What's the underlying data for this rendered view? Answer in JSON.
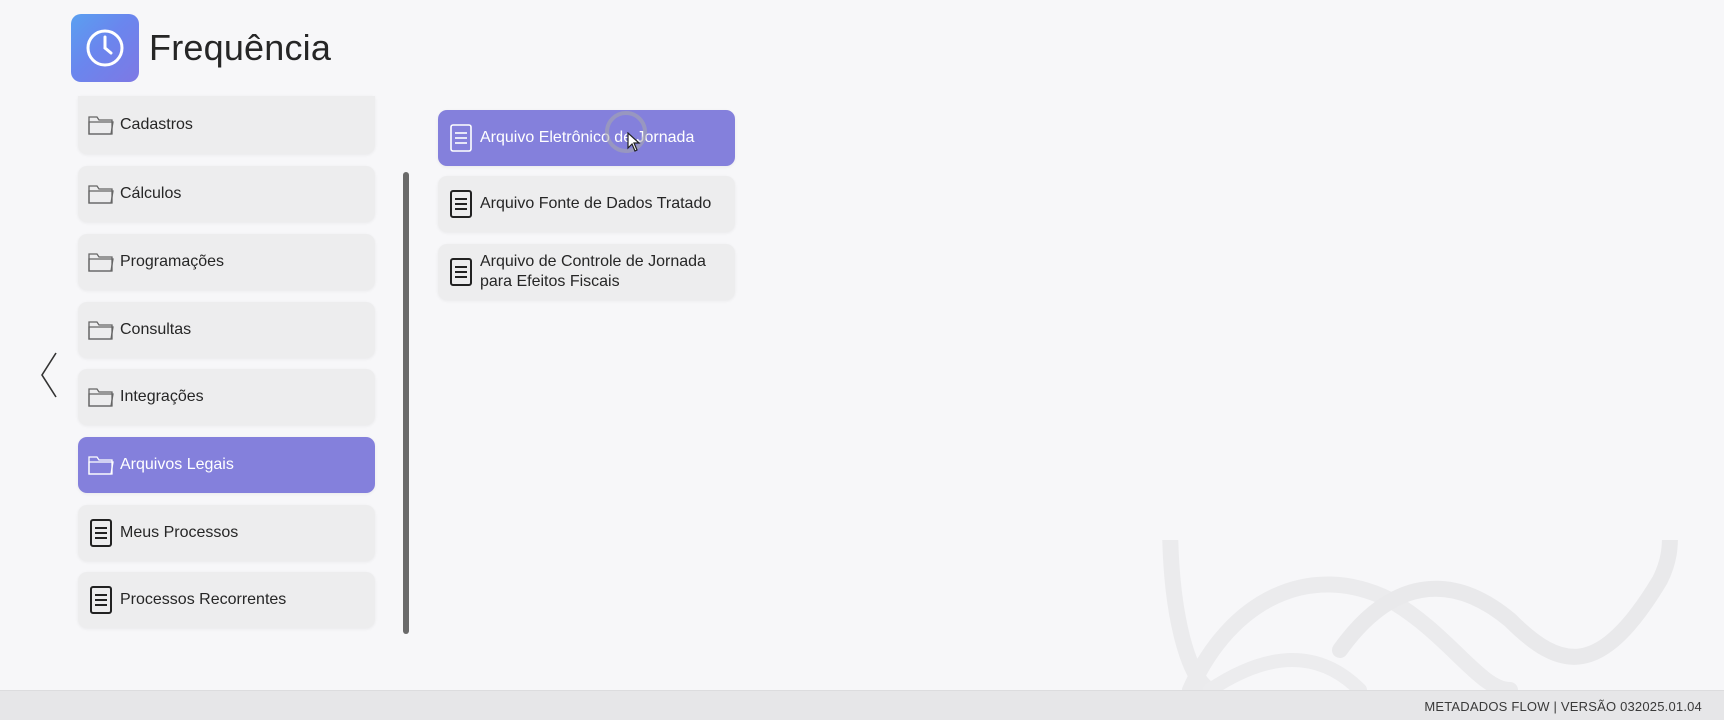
{
  "app": {
    "title": "Frequência",
    "logo_icon": "clock-icon",
    "accent_color": "#8480dc"
  },
  "navigation": {
    "back_icon": "chevron-left-icon"
  },
  "sidebar": {
    "items": [
      {
        "label": "Cadastros",
        "icon": "folder-icon",
        "active": false
      },
      {
        "label": "Cálculos",
        "icon": "folder-icon",
        "active": false
      },
      {
        "label": "Programações",
        "icon": "folder-icon",
        "active": false
      },
      {
        "label": "Consultas",
        "icon": "folder-icon",
        "active": false
      },
      {
        "label": "Integrações",
        "icon": "folder-icon",
        "active": false
      },
      {
        "label": "Arquivos Legais",
        "icon": "folder-icon",
        "active": true
      },
      {
        "label": "Meus Processos",
        "icon": "document-icon",
        "active": false
      },
      {
        "label": "Processos Recorrentes",
        "icon": "document-icon",
        "active": false
      }
    ]
  },
  "submenu": {
    "items": [
      {
        "label": "Arquivo Eletrônico de Jornada",
        "icon": "document-icon",
        "active": true
      },
      {
        "label": "Arquivo Fonte de Dados Tratado",
        "icon": "document-icon",
        "active": false
      },
      {
        "label": "Arquivo de Controle de Jornada para Efeitos Fiscais",
        "icon": "document-icon",
        "active": false
      }
    ]
  },
  "footer": {
    "text": "METADADOS FLOW | VERSÃO 032025.01.04"
  }
}
